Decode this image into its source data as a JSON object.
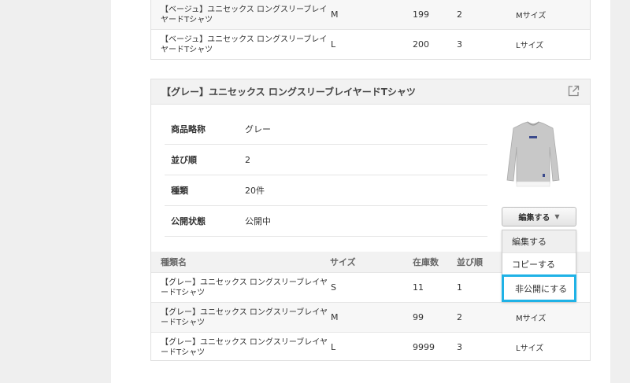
{
  "top_table": {
    "rows": [
      {
        "name": "【ベージュ】ユニセックス ロングスリーブレイヤードTシャツ",
        "size": "M",
        "stock": "199",
        "order": "2",
        "label": "Mサイズ"
      },
      {
        "name": "【ベージュ】ユニセックス ロングスリーブレイヤードTシャツ",
        "size": "L",
        "stock": "200",
        "order": "3",
        "label": "Lサイズ"
      }
    ]
  },
  "card": {
    "title": "【グレー】ユニセックス ロングスリーブレイヤードTシャツ",
    "info": [
      {
        "label": "商品略称",
        "value": "グレー"
      },
      {
        "label": "並び順",
        "value": "2"
      },
      {
        "label": "種類",
        "value": "20件"
      },
      {
        "label": "公開状態",
        "value": "公開中"
      }
    ],
    "edit_button": "編集する",
    "columns": {
      "name": "種類名",
      "size": "サイズ",
      "stock": "在庫数",
      "order": "並び順"
    },
    "rows": [
      {
        "name": "【グレー】ユニセックス ロングスリーブレイヤードTシャツ",
        "size": "S",
        "stock": "11",
        "order": "1",
        "label": ""
      },
      {
        "name": "【グレー】ユニセックス ロングスリーブレイヤードTシャツ",
        "size": "M",
        "stock": "99",
        "order": "2",
        "label": "Mサイズ"
      },
      {
        "name": "【グレー】ユニセックス ロングスリーブレイヤードTシャツ",
        "size": "L",
        "stock": "9999",
        "order": "3",
        "label": "Lサイズ"
      }
    ]
  },
  "dropdown": {
    "items": [
      "編集する",
      "コピーする",
      "非公開にする"
    ]
  },
  "icons": {
    "external": "external-link-icon",
    "shirt": "product-image"
  },
  "colors": {
    "highlight": "#1fb2e6"
  }
}
